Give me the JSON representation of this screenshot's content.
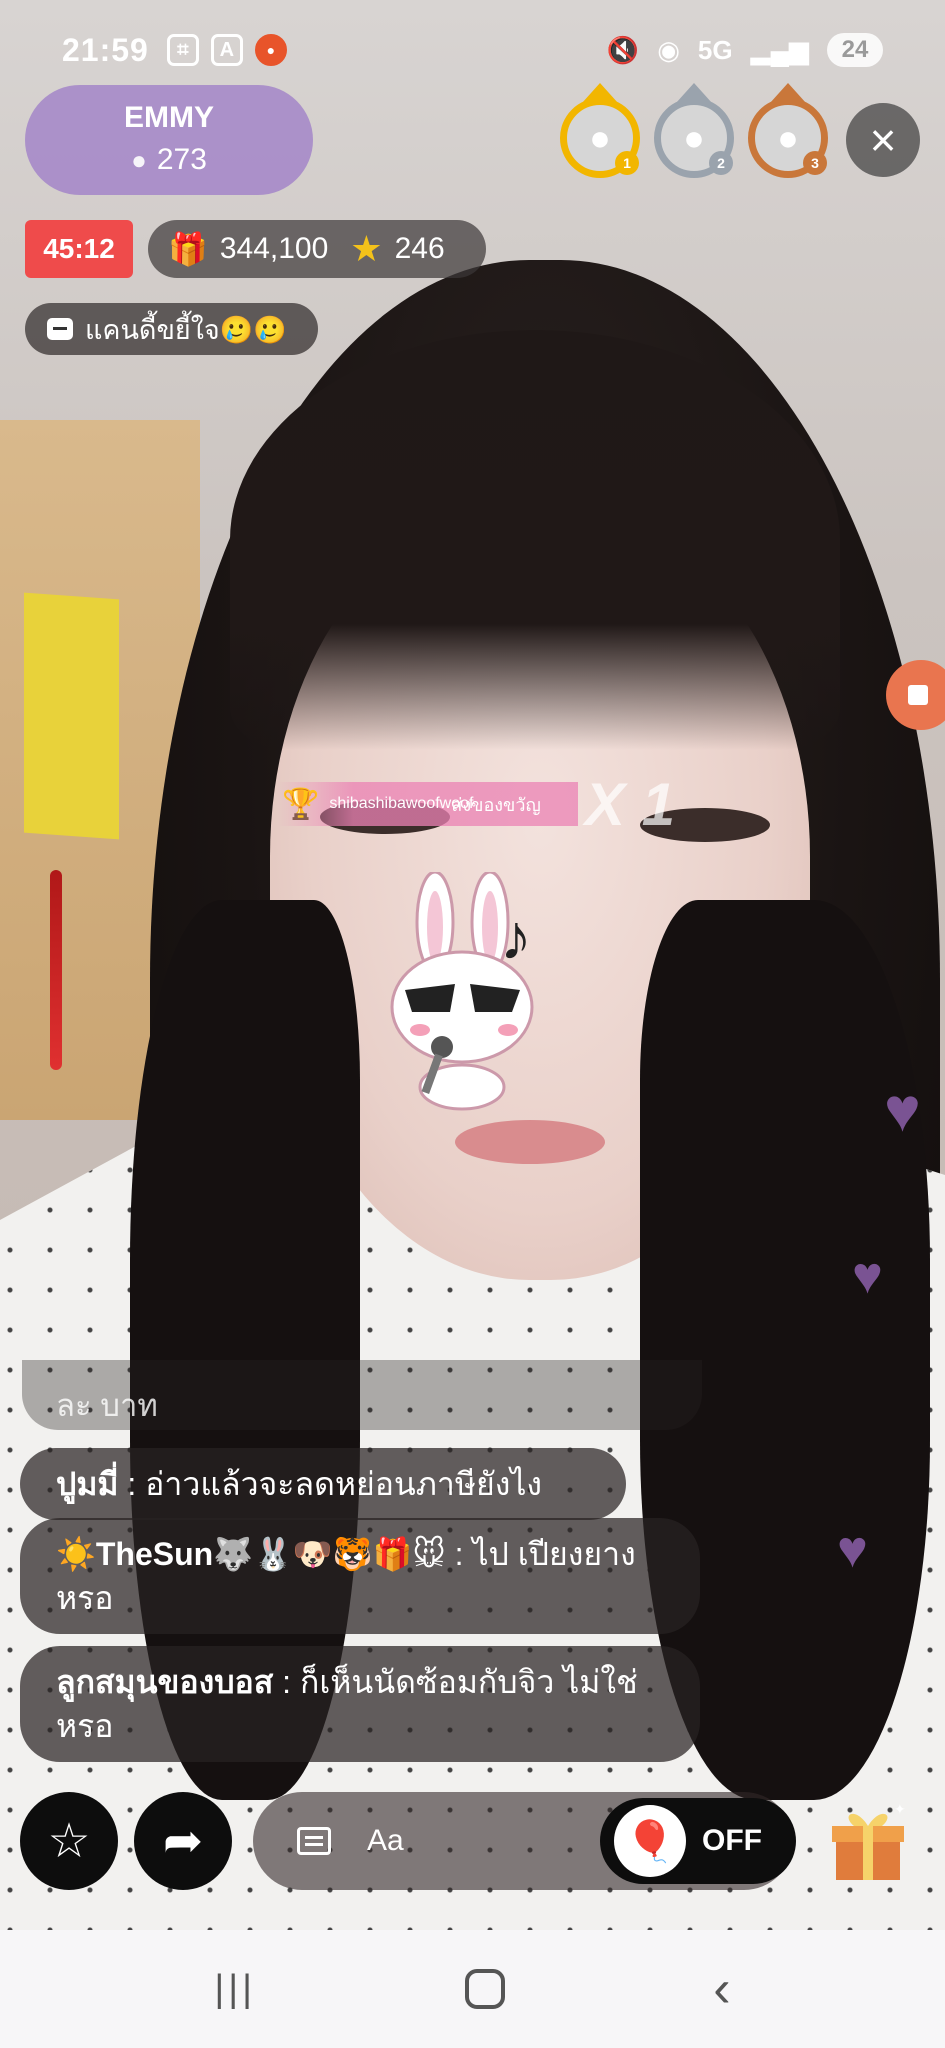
{
  "status_bar": {
    "time": "21:59",
    "network": "5G",
    "battery": "24",
    "icons": [
      "screenshot-icon",
      "accessibility-icon",
      "screen-record-icon",
      "mute-icon",
      "hotspot-icon",
      "signal-icon"
    ]
  },
  "host": {
    "name": "EMMY",
    "viewer_count": "273"
  },
  "top_viewers": [
    {
      "rank": "1",
      "tier": "gold"
    },
    {
      "rank": "2",
      "tier": "silver"
    },
    {
      "rank": "3",
      "tier": "bronze"
    }
  ],
  "stream": {
    "timer": "45:12",
    "gifts": "344,100",
    "stars": "246",
    "announcement": "แคนดี้ขยี้ใจ🥲🥲"
  },
  "gift_banner": {
    "sender": "shibashibawoofwoof",
    "action": "ส่งของขวัญ",
    "multiplier": "X 1"
  },
  "chat": {
    "faded_message": "ละ บาท",
    "messages": [
      {
        "user": "ปูมมี่",
        "separator": " : ",
        "text": "อ่าวแล้วจะลดหย่อนภาษียังไง"
      },
      {
        "user": "☀️TheSun🐺🐰🐶🐯🎁🐭",
        "separator": " : ",
        "text": "ไป เปียงยาง หรอ"
      },
      {
        "user": "ลูกสมุนของบอส",
        "separator": " : ",
        "text": "ก็เห็นนัดซ้อมกับจิว ไม่ใช่หรอ"
      }
    ]
  },
  "toolbar": {
    "input_placeholder": "Aa",
    "balloon_state": "OFF"
  },
  "colors": {
    "host_card": "#a587c8",
    "timer": "#ef4b4b",
    "gold": "#f2b600",
    "silver": "#9aa3ad",
    "bronze": "#c9773a",
    "heart": "#8c5faa"
  }
}
